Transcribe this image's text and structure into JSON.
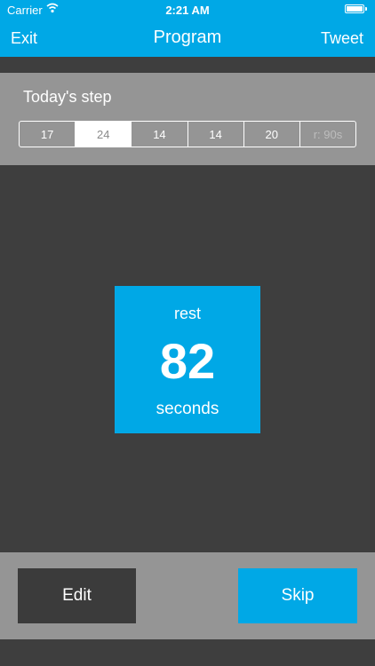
{
  "status_bar": {
    "carrier": "Carrier",
    "time": "2:21 AM",
    "wifi_icon": "wifi-icon",
    "battery_icon": "battery-icon"
  },
  "nav": {
    "left": "Exit",
    "title": "Program",
    "right": "Tweet"
  },
  "step": {
    "label": "Today's step",
    "segments": [
      "17",
      "24",
      "14",
      "14",
      "20",
      "r: 90s"
    ],
    "selected_index": 1
  },
  "rest": {
    "label": "rest",
    "value": "82",
    "unit": "seconds"
  },
  "actions": {
    "edit": "Edit",
    "skip": "Skip"
  },
  "colors": {
    "accent": "#00a8e6",
    "panel": "#959595",
    "background": "#3e3e3e",
    "dark_button": "#3b3b3b"
  }
}
